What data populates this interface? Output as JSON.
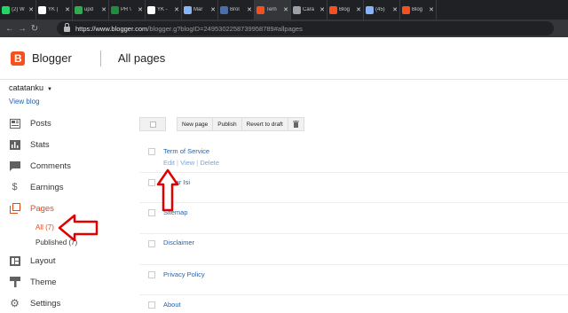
{
  "browser": {
    "tabs": [
      {
        "title": "(2) W",
        "color": "#25d366"
      },
      {
        "title": "YK |",
        "color": "#ffffff"
      },
      {
        "title": "upd",
        "color": "#34a853"
      },
      {
        "title": "PR \\",
        "color": "#1e8e3e"
      },
      {
        "title": "YK -",
        "color": "#ffffff"
      },
      {
        "title": "Mar",
        "color": "#8ab4f8"
      },
      {
        "title": "Brol",
        "color": "#4a6fa5"
      },
      {
        "title": "Tern",
        "color": "#f4511e"
      },
      {
        "title": "Cara",
        "color": "#9aa0a6"
      },
      {
        "title": "Blog",
        "color": "#f4511e"
      },
      {
        "title": "(45)",
        "color": "#8ab4f8"
      },
      {
        "title": "Blog",
        "color": "#f4511e"
      }
    ],
    "url_host": "https://www.blogger.com",
    "url_path": "/blogger.g?blogID=2495302258739958789#allpages"
  },
  "header": {
    "brand": "Blogger",
    "title": "All pages"
  },
  "sidebar": {
    "blog_name": "catatanku",
    "view_blog": "View blog",
    "items": [
      {
        "label": "Posts",
        "icon": "posts-icon"
      },
      {
        "label": "Stats",
        "icon": "stats-icon"
      },
      {
        "label": "Comments",
        "icon": "comments-icon"
      },
      {
        "label": "Earnings",
        "icon": "earnings-icon"
      },
      {
        "label": "Pages",
        "icon": "pages-icon"
      },
      {
        "label": "Layout",
        "icon": "layout-icon"
      },
      {
        "label": "Theme",
        "icon": "theme-icon"
      },
      {
        "label": "Settings",
        "icon": "settings-icon"
      }
    ],
    "sub_items": [
      {
        "label": "All (7)"
      },
      {
        "label": "Published (7)"
      }
    ]
  },
  "toolbar": {
    "new_page": "New page",
    "publish": "Publish",
    "revert": "Revert to draft",
    "delete_icon": "trash-icon"
  },
  "pages": [
    {
      "title": "Term of Service"
    },
    {
      "title": "Daftar Isi"
    },
    {
      "title": "Sitemap"
    },
    {
      "title": "Disclaimer"
    },
    {
      "title": "Privacy Policy"
    },
    {
      "title": "About"
    }
  ],
  "row_actions": {
    "edit": "Edit",
    "view": "View",
    "delete": "Delete"
  },
  "colors": {
    "accent": "#e64a19",
    "link": "#2962a8",
    "annotation": "#e00000"
  }
}
